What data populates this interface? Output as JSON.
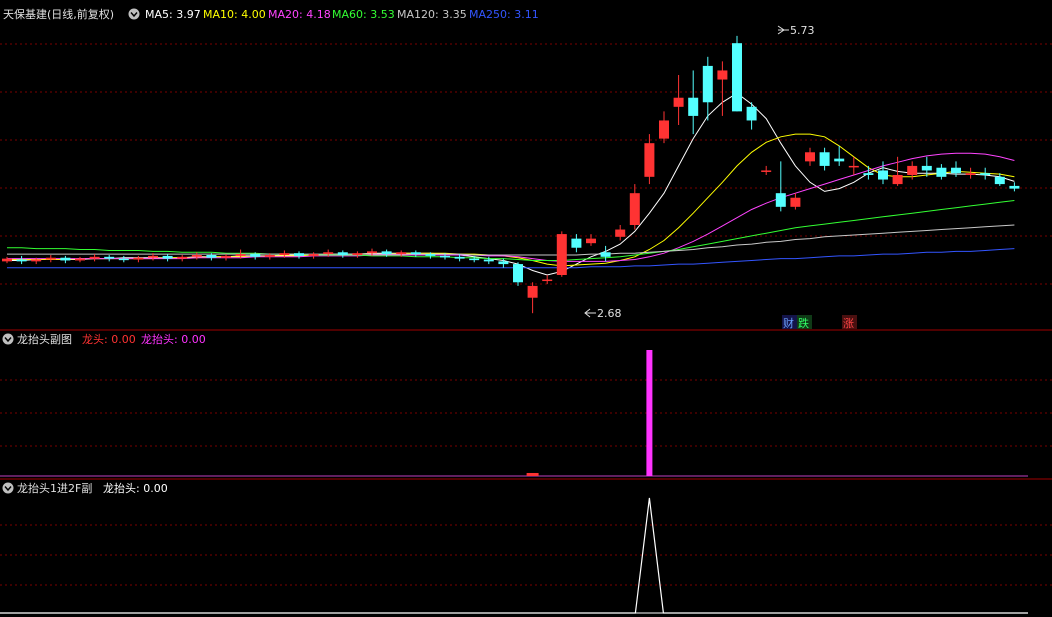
{
  "main_panel": {
    "stock": "天保基建(日线,前复权)",
    "indicators": [
      {
        "label": "MA5: 3.97",
        "color": "#ffffff"
      },
      {
        "label": "MA10: 4.00",
        "color": "#ffff00"
      },
      {
        "label": "MA20: 4.18",
        "color": "#ff44ff"
      },
      {
        "label": "MA60: 3.53",
        "color": "#33ff33"
      },
      {
        "label": "MA120: 3.35",
        "color": "#c8c8c8"
      },
      {
        "label": "MA250: 3.11",
        "color": "#3355ff"
      }
    ],
    "high_label": "5.73",
    "low_label": "2.68",
    "markers": [
      {
        "text": "财",
        "color": "#6aa0ff"
      },
      {
        "text": "跌",
        "color": "#33ff66"
      },
      {
        "text": "涨",
        "color": "#ff4444"
      }
    ]
  },
  "sub1": {
    "title": "龙抬头副图",
    "items": [
      {
        "label": "龙头: 0.00",
        "color": "#ff3333"
      },
      {
        "label": "龙抬头: 0.00",
        "color": "#ff33ff"
      }
    ]
  },
  "sub2": {
    "title": "龙抬头1进2F副",
    "items": [
      {
        "label": "龙抬头: 0.00",
        "color": "#ffffff"
      }
    ]
  },
  "colors": {
    "up": "#ff3333",
    "down": "#54ffff",
    "grid": "#7a0000",
    "border": "#a00000"
  },
  "chart_data": {
    "type": "candlestick",
    "candles": [
      [
        3.25,
        3.28,
        3.3,
        3.23
      ],
      [
        3.27,
        3.25,
        3.31,
        3.22
      ],
      [
        3.25,
        3.27,
        3.29,
        3.22
      ],
      [
        3.27,
        3.29,
        3.32,
        3.24
      ],
      [
        3.29,
        3.26,
        3.31,
        3.23
      ],
      [
        3.26,
        3.28,
        3.3,
        3.24
      ],
      [
        3.28,
        3.3,
        3.33,
        3.25
      ],
      [
        3.3,
        3.28,
        3.32,
        3.25
      ],
      [
        3.28,
        3.27,
        3.31,
        3.24
      ],
      [
        3.27,
        3.29,
        3.31,
        3.24
      ],
      [
        3.29,
        3.31,
        3.34,
        3.26
      ],
      [
        3.31,
        3.28,
        3.33,
        3.25
      ],
      [
        3.28,
        3.3,
        3.32,
        3.25
      ],
      [
        3.3,
        3.32,
        3.35,
        3.27
      ],
      [
        3.32,
        3.29,
        3.34,
        3.26
      ],
      [
        3.29,
        3.31,
        3.33,
        3.26
      ],
      [
        3.31,
        3.33,
        3.38,
        3.28
      ],
      [
        3.33,
        3.3,
        3.35,
        3.27
      ],
      [
        3.3,
        3.32,
        3.34,
        3.27
      ],
      [
        3.32,
        3.34,
        3.37,
        3.29
      ],
      [
        3.34,
        3.31,
        3.36,
        3.28
      ],
      [
        3.31,
        3.33,
        3.35,
        3.28
      ],
      [
        3.33,
        3.35,
        3.38,
        3.3
      ],
      [
        3.35,
        3.32,
        3.37,
        3.29
      ],
      [
        3.32,
        3.34,
        3.36,
        3.29
      ],
      [
        3.34,
        3.36,
        3.39,
        3.31
      ],
      [
        3.36,
        3.33,
        3.38,
        3.3
      ],
      [
        3.33,
        3.35,
        3.37,
        3.3
      ],
      [
        3.35,
        3.33,
        3.37,
        3.3
      ],
      [
        3.33,
        3.31,
        3.35,
        3.28
      ],
      [
        3.31,
        3.3,
        3.34,
        3.27
      ],
      [
        3.3,
        3.28,
        3.33,
        3.25
      ],
      [
        3.28,
        3.27,
        3.31,
        3.24
      ],
      [
        3.27,
        3.25,
        3.3,
        3.22
      ],
      [
        3.25,
        3.22,
        3.28,
        3.18
      ],
      [
        3.22,
        3.02,
        3.24,
        2.98
      ],
      [
        2.85,
        2.98,
        3.02,
        2.68
      ],
      [
        3.05,
        3.05,
        3.1,
        3.0
      ],
      [
        3.1,
        3.55,
        3.58,
        3.08
      ],
      [
        3.5,
        3.4,
        3.55,
        3.35
      ],
      [
        3.45,
        3.5,
        3.55,
        3.42
      ],
      [
        3.35,
        3.3,
        3.42,
        3.25
      ],
      [
        3.52,
        3.6,
        3.65,
        3.48
      ],
      [
        3.65,
        4.0,
        4.1,
        3.6
      ],
      [
        4.18,
        4.55,
        4.65,
        4.1
      ],
      [
        4.6,
        4.8,
        4.9,
        4.55
      ],
      [
        4.95,
        5.05,
        5.3,
        4.75
      ],
      [
        5.05,
        4.85,
        5.35,
        4.65
      ],
      [
        5.4,
        5.0,
        5.5,
        4.8
      ],
      [
        5.25,
        5.35,
        5.45,
        4.85
      ],
      [
        5.65,
        4.9,
        5.73,
        4.9
      ],
      [
        4.95,
        4.8,
        5.0,
        4.7
      ],
      [
        4.25,
        4.25,
        4.3,
        4.2
      ],
      [
        4.0,
        3.85,
        4.35,
        3.8
      ],
      [
        3.85,
        3.95,
        4.0,
        3.82
      ],
      [
        4.35,
        4.45,
        4.5,
        4.3
      ],
      [
        4.45,
        4.3,
        4.5,
        4.25
      ],
      [
        4.38,
        4.35,
        4.52,
        4.3
      ],
      [
        4.3,
        4.3,
        4.4,
        4.2
      ],
      [
        4.22,
        4.2,
        4.3,
        4.15
      ],
      [
        4.25,
        4.15,
        4.35,
        4.1
      ],
      [
        4.1,
        4.2,
        4.4,
        4.08
      ],
      [
        4.2,
        4.3,
        4.35,
        4.15
      ],
      [
        4.3,
        4.25,
        4.4,
        4.18
      ],
      [
        4.28,
        4.18,
        4.32,
        4.15
      ],
      [
        4.28,
        4.22,
        4.35,
        4.18
      ],
      [
        4.2,
        4.22,
        4.28,
        4.16
      ],
      [
        4.22,
        4.2,
        4.28,
        4.15
      ],
      [
        4.18,
        4.1,
        4.22,
        4.08
      ],
      [
        4.08,
        4.05,
        4.12,
        4.02
      ]
    ],
    "series": [
      {
        "name": "MA5",
        "color": "#ffffff",
        "values": [
          3.26,
          3.26,
          3.27,
          3.27,
          3.27,
          3.27,
          3.28,
          3.28,
          3.29,
          3.29,
          3.29,
          3.29,
          3.29,
          3.3,
          3.3,
          3.3,
          3.31,
          3.31,
          3.31,
          3.32,
          3.32,
          3.32,
          3.33,
          3.33,
          3.33,
          3.34,
          3.34,
          3.34,
          3.34,
          3.34,
          3.33,
          3.32,
          3.3,
          3.28,
          3.26,
          3.22,
          3.15,
          3.1,
          3.14,
          3.22,
          3.3,
          3.36,
          3.44,
          3.58,
          3.78,
          4.0,
          4.3,
          4.6,
          4.85,
          5.0,
          5.1,
          4.98,
          4.82,
          4.55,
          4.3,
          4.12,
          4.02,
          4.05,
          4.12,
          4.22,
          4.28,
          4.24,
          4.22,
          4.22,
          4.22,
          4.21,
          4.21,
          4.2,
          4.18,
          4.13
        ]
      },
      {
        "name": "MA10",
        "color": "#ffff00",
        "values": [
          3.27,
          3.27,
          3.27,
          3.27,
          3.27,
          3.28,
          3.28,
          3.28,
          3.28,
          3.28,
          3.28,
          3.29,
          3.29,
          3.29,
          3.3,
          3.3,
          3.3,
          3.3,
          3.31,
          3.31,
          3.31,
          3.32,
          3.32,
          3.32,
          3.33,
          3.33,
          3.33,
          3.34,
          3.34,
          3.34,
          3.34,
          3.33,
          3.33,
          3.32,
          3.31,
          3.29,
          3.26,
          3.22,
          3.2,
          3.21,
          3.22,
          3.23,
          3.26,
          3.3,
          3.38,
          3.48,
          3.62,
          3.78,
          3.95,
          4.12,
          4.3,
          4.45,
          4.56,
          4.62,
          4.65,
          4.65,
          4.62,
          4.52,
          4.4,
          4.28,
          4.2,
          4.18,
          4.18,
          4.2,
          4.22,
          4.24,
          4.23,
          4.22,
          4.21,
          4.18
        ]
      },
      {
        "name": "MA20",
        "color": "#ff44ff",
        "values": [
          3.28,
          3.28,
          3.28,
          3.28,
          3.28,
          3.28,
          3.28,
          3.28,
          3.28,
          3.28,
          3.28,
          3.28,
          3.28,
          3.29,
          3.29,
          3.29,
          3.29,
          3.3,
          3.3,
          3.3,
          3.3,
          3.31,
          3.31,
          3.31,
          3.31,
          3.32,
          3.32,
          3.32,
          3.32,
          3.32,
          3.32,
          3.32,
          3.32,
          3.31,
          3.31,
          3.3,
          3.28,
          3.26,
          3.25,
          3.25,
          3.25,
          3.25,
          3.26,
          3.27,
          3.3,
          3.34,
          3.4,
          3.47,
          3.55,
          3.64,
          3.73,
          3.82,
          3.89,
          3.95,
          4.0,
          4.05,
          4.1,
          4.15,
          4.2,
          4.25,
          4.3,
          4.34,
          4.38,
          4.41,
          4.43,
          4.44,
          4.44,
          4.43,
          4.4,
          4.36
        ]
      },
      {
        "name": "MA60",
        "color": "#33ff33",
        "values": [
          3.4,
          3.4,
          3.39,
          3.39,
          3.39,
          3.38,
          3.38,
          3.37,
          3.37,
          3.37,
          3.36,
          3.36,
          3.35,
          3.35,
          3.35,
          3.34,
          3.34,
          3.34,
          3.33,
          3.33,
          3.33,
          3.32,
          3.32,
          3.32,
          3.32,
          3.31,
          3.31,
          3.31,
          3.3,
          3.3,
          3.3,
          3.29,
          3.29,
          3.28,
          3.28,
          3.27,
          3.26,
          3.26,
          3.26,
          3.27,
          3.28,
          3.29,
          3.3,
          3.32,
          3.34,
          3.36,
          3.38,
          3.41,
          3.44,
          3.47,
          3.5,
          3.53,
          3.56,
          3.59,
          3.62,
          3.64,
          3.66,
          3.68,
          3.7,
          3.72,
          3.74,
          3.76,
          3.78,
          3.8,
          3.82,
          3.84,
          3.86,
          3.88,
          3.9,
          3.92
        ]
      },
      {
        "name": "MA120",
        "color": "#c8c8c8",
        "values": [
          3.33,
          3.33,
          3.33,
          3.33,
          3.33,
          3.33,
          3.33,
          3.33,
          3.33,
          3.33,
          3.33,
          3.33,
          3.33,
          3.33,
          3.33,
          3.33,
          3.33,
          3.33,
          3.33,
          3.33,
          3.33,
          3.33,
          3.33,
          3.33,
          3.33,
          3.33,
          3.33,
          3.33,
          3.33,
          3.33,
          3.33,
          3.33,
          3.32,
          3.32,
          3.32,
          3.32,
          3.32,
          3.32,
          3.32,
          3.32,
          3.33,
          3.33,
          3.34,
          3.34,
          3.35,
          3.36,
          3.37,
          3.38,
          3.4,
          3.41,
          3.43,
          3.44,
          3.46,
          3.47,
          3.49,
          3.5,
          3.52,
          3.53,
          3.54,
          3.55,
          3.56,
          3.57,
          3.58,
          3.59,
          3.6,
          3.61,
          3.62,
          3.63,
          3.64,
          3.65
        ]
      },
      {
        "name": "MA250",
        "color": "#3355ff",
        "values": [
          3.18,
          3.18,
          3.18,
          3.18,
          3.18,
          3.18,
          3.18,
          3.18,
          3.18,
          3.18,
          3.18,
          3.18,
          3.18,
          3.18,
          3.18,
          3.18,
          3.18,
          3.18,
          3.18,
          3.18,
          3.18,
          3.18,
          3.18,
          3.18,
          3.18,
          3.18,
          3.18,
          3.18,
          3.18,
          3.18,
          3.18,
          3.18,
          3.18,
          3.18,
          3.18,
          3.18,
          3.18,
          3.18,
          3.18,
          3.18,
          3.19,
          3.19,
          3.19,
          3.2,
          3.2,
          3.21,
          3.22,
          3.22,
          3.23,
          3.24,
          3.25,
          3.26,
          3.27,
          3.28,
          3.28,
          3.29,
          3.3,
          3.31,
          3.31,
          3.32,
          3.33,
          3.33,
          3.34,
          3.35,
          3.35,
          3.36,
          3.36,
          3.37,
          3.38,
          3.39
        ]
      }
    ],
    "ylim": [
      2.55,
      5.85
    ],
    "sub1_values": {
      "idx_small": 36,
      "small": 0.08,
      "idx_big": 44,
      "big": 1.0
    },
    "sub2_values": {
      "peak_idx": 44,
      "peak": 1.0
    }
  }
}
